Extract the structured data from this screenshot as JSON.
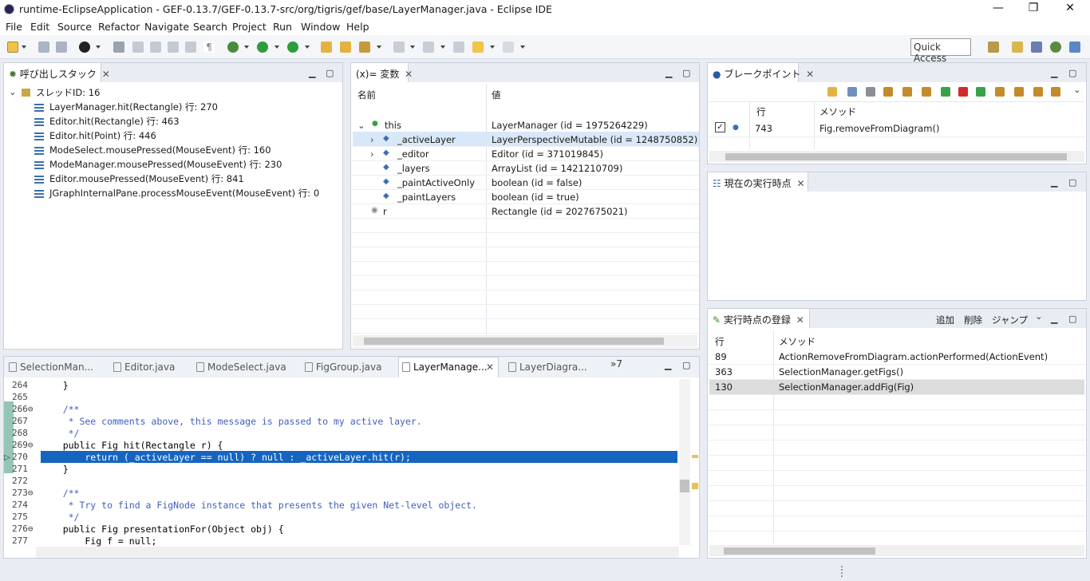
{
  "window": {
    "title": "runtime-EclipseApplication - GEF-0.13.7/GEF-0.13.7-src/org/tigris/gef/base/LayerManager.java - Eclipse IDE"
  },
  "menu": [
    "File",
    "Edit",
    "Source",
    "Refactor",
    "Navigate",
    "Search",
    "Project",
    "Run",
    "Window",
    "Help"
  ],
  "toolbar": {
    "quick_access": "Quick Access"
  },
  "callstack": {
    "tab": "呼び出しスタック",
    "thread": "スレッドID: 16",
    "frames": [
      "LayerManager.hit(Rectangle) 行: 270",
      "Editor.hit(Rectangle) 行: 463",
      "Editor.hit(Point) 行: 446",
      "ModeSelect.mousePressed(MouseEvent) 行: 160",
      "ModeManager.mousePressed(MouseEvent) 行: 230",
      "Editor.mousePressed(MouseEvent) 行: 841",
      "JGraphInternalPane.processMouseEvent(MouseEvent) 行: 0"
    ]
  },
  "variables": {
    "tab": "(x)= 変数",
    "col_name": "名前",
    "col_value": "値",
    "rows": [
      {
        "name": "this",
        "value": "LayerManager (id = 1975264229)"
      },
      {
        "name": "_activeLayer",
        "value": "LayerPerspectiveMutable (id = 1248750852)"
      },
      {
        "name": "_editor",
        "value": "Editor (id = 371019845)"
      },
      {
        "name": "_layers",
        "value": "ArrayList (id = 1421210709)"
      },
      {
        "name": "_paintActiveOnly",
        "value": "boolean (id = false)"
      },
      {
        "name": "_paintLayers",
        "value": "boolean (id = true)"
      },
      {
        "name": "r",
        "value": "Rectangle (id = 2027675021)"
      }
    ]
  },
  "breakpoints": {
    "tab": "ブレークポイント",
    "col_line": "行",
    "col_method": "メソッド",
    "rows": [
      {
        "line": "743",
        "method": "Fig.removeFromDiagram()"
      }
    ]
  },
  "current_point": {
    "tab": "現在の実行時点"
  },
  "registry": {
    "tab": "実行時点の登録",
    "add": "追加",
    "delete": "削除",
    "jump": "ジャンプ",
    "col_line": "行",
    "col_method": "メソッド",
    "rows": [
      {
        "line": "89",
        "method": "ActionRemoveFromDiagram.actionPerformed(ActionEvent)"
      },
      {
        "line": "363",
        "method": "SelectionManager.getFigs()"
      },
      {
        "line": "130",
        "method": "SelectionManager.addFig(Fig)"
      }
    ]
  },
  "editor": {
    "tabs": [
      "SelectionMan...",
      "Editor.java",
      "ModeSelect.java",
      "FigGroup.java",
      "LayerManage...",
      "LayerDiagra..."
    ],
    "overflow": "»7",
    "lines": [
      {
        "n": "264",
        "code": "    }"
      },
      {
        "n": "265",
        "code": ""
      },
      {
        "n": "266⊖",
        "code": "    /**"
      },
      {
        "n": "267",
        "code": "     * See comments above, this message is passed to my active layer."
      },
      {
        "n": "268",
        "code": "     */"
      },
      {
        "n": "269⊖",
        "code": "    public Fig hit(Rectangle r) {"
      },
      {
        "n": "270",
        "code": "        return (_activeLayer == null) ? null : _activeLayer.hit(r);"
      },
      {
        "n": "271",
        "code": "    }"
      },
      {
        "n": "272",
        "code": ""
      },
      {
        "n": "273⊖",
        "code": "    /**"
      },
      {
        "n": "274",
        "code": "     * Try to find a FigNode instance that presents the given Net-level object."
      },
      {
        "n": "275",
        "code": "     */"
      },
      {
        "n": "276⊖",
        "code": "    public Fig presentationFor(Object obj) {"
      },
      {
        "n": "277",
        "code": "        Fig f = null;"
      }
    ]
  },
  "colors": {
    "selection": "#d9e8f8",
    "current_line": "#1565c0",
    "comment": "#3f5fbf",
    "keyword": "#7f0055"
  }
}
